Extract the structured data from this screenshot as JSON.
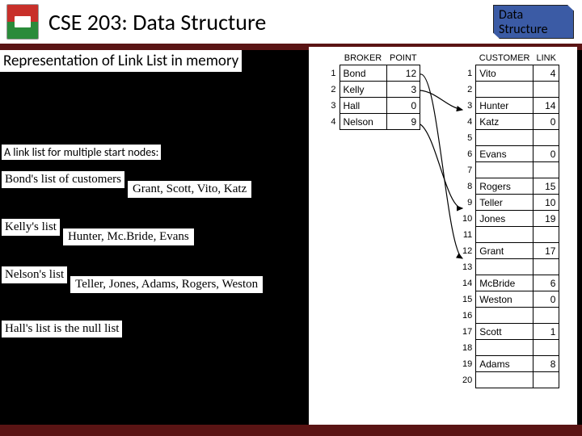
{
  "header": {
    "course_title": "CSE 203: Data Structure",
    "badge_line1": "Data",
    "badge_line2": "Structure"
  },
  "subtitle": "Representation of Link List in memory",
  "section_label": "A link list for multiple start nodes:",
  "customer_lists": [
    {
      "label": "Bond's list of customers",
      "items": "Grant, Scott, Vito, Katz"
    },
    {
      "label": "Kelly's list",
      "items": "Hunter, Mc.Bride, Evans"
    },
    {
      "label": "Nelson's list",
      "items": "Teller, Jones, Adams, Rogers, Weston"
    }
  ],
  "null_list": "Hall's list is the null list",
  "broker_table": {
    "headers": [
      "BROKER",
      "POINT"
    ],
    "rows": [
      {
        "idx": "1",
        "name": "Bond",
        "point": "12"
      },
      {
        "idx": "2",
        "name": "Kelly",
        "point": "3"
      },
      {
        "idx": "3",
        "name": "Hall",
        "point": "0"
      },
      {
        "idx": "4",
        "name": "Nelson",
        "point": "9"
      }
    ]
  },
  "customer_table": {
    "headers": [
      "CUSTOMER",
      "LINK"
    ],
    "rows": [
      {
        "idx": "1",
        "name": "Vito",
        "link": "4"
      },
      {
        "idx": "2",
        "name": "",
        "link": ""
      },
      {
        "idx": "3",
        "name": "Hunter",
        "link": "14"
      },
      {
        "idx": "4",
        "name": "Katz",
        "link": "0"
      },
      {
        "idx": "5",
        "name": "",
        "link": ""
      },
      {
        "idx": "6",
        "name": "Evans",
        "link": "0"
      },
      {
        "idx": "7",
        "name": "",
        "link": ""
      },
      {
        "idx": "8",
        "name": "Rogers",
        "link": "15"
      },
      {
        "idx": "9",
        "name": "Teller",
        "link": "10"
      },
      {
        "idx": "10",
        "name": "Jones",
        "link": "19"
      },
      {
        "idx": "11",
        "name": "",
        "link": ""
      },
      {
        "idx": "12",
        "name": "Grant",
        "link": "17"
      },
      {
        "idx": "13",
        "name": "",
        "link": ""
      },
      {
        "idx": "14",
        "name": "McBride",
        "link": "6"
      },
      {
        "idx": "15",
        "name": "Weston",
        "link": "0"
      },
      {
        "idx": "16",
        "name": "",
        "link": ""
      },
      {
        "idx": "17",
        "name": "Scott",
        "link": "1"
      },
      {
        "idx": "18",
        "name": "",
        "link": ""
      },
      {
        "idx": "19",
        "name": "Adams",
        "link": "8"
      },
      {
        "idx": "20",
        "name": "",
        "link": ""
      }
    ]
  }
}
